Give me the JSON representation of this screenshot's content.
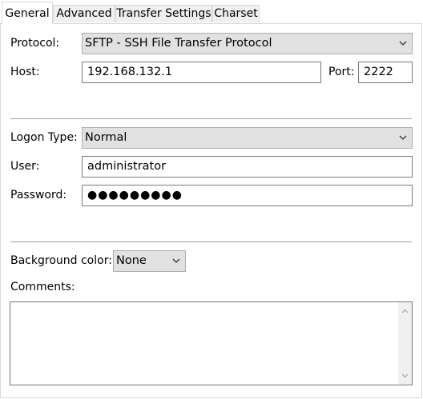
{
  "tabs": [
    {
      "label": "General"
    },
    {
      "label": "Advanced"
    },
    {
      "label": "Transfer Settings"
    },
    {
      "label": "Charset"
    }
  ],
  "protocol": {
    "label": "Protocol:",
    "value": "SFTP - SSH File Transfer Protocol"
  },
  "host": {
    "label": "Host:",
    "value": "192.168.132.1"
  },
  "port": {
    "label": "Port:",
    "value": "2222"
  },
  "logon_type": {
    "label": "Logon Type:",
    "value": "Normal"
  },
  "user": {
    "label": "User:",
    "value": "administrator"
  },
  "password": {
    "label": "Password:",
    "value": "●●●●●●●●●"
  },
  "background_color": {
    "label": "Background color:",
    "value": "None"
  },
  "comments": {
    "label": "Comments:",
    "value": ""
  }
}
